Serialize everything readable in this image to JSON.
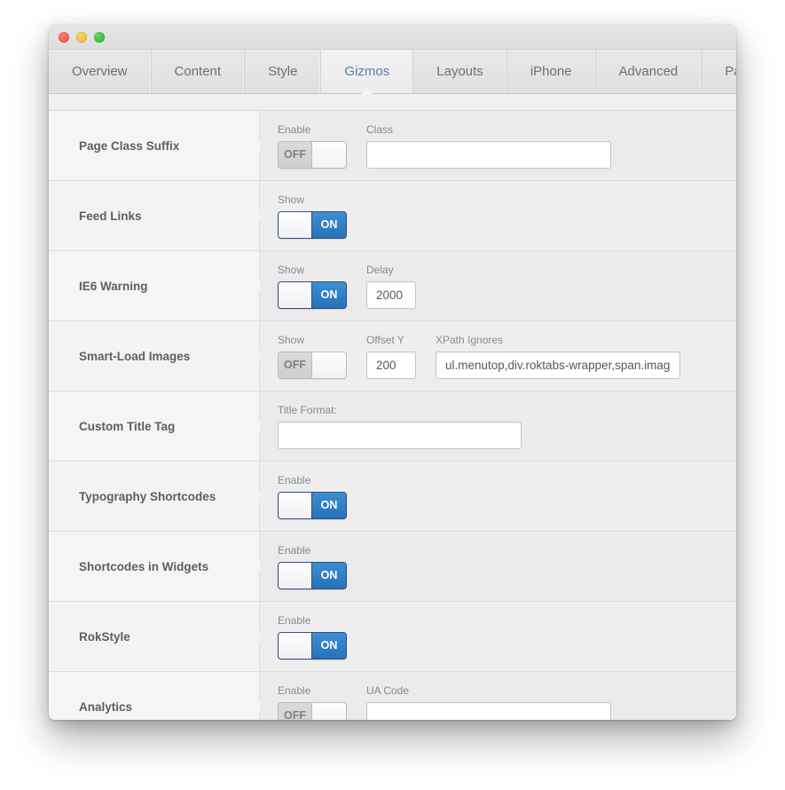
{
  "window": {
    "traffic_lights": [
      "close",
      "minimize",
      "maximize"
    ]
  },
  "tabs": [
    {
      "label": "Overview",
      "active": false
    },
    {
      "label": "Content",
      "active": false
    },
    {
      "label": "Style",
      "active": false
    },
    {
      "label": "Gizmos",
      "active": true
    },
    {
      "label": "Layouts",
      "active": false
    },
    {
      "label": "iPhone",
      "active": false
    },
    {
      "label": "Advanced",
      "active": false
    },
    {
      "label": "Page Templates",
      "active": false
    }
  ],
  "colors": {
    "accent_blue": "#2b7cc4",
    "active_tab_text": "#5579b4",
    "label_text": "#5a5f66",
    "field_label_text": "#868a8e"
  },
  "rows": [
    {
      "title": "Page Class Suffix",
      "toggle_label": "Enable",
      "toggle_state": "OFF",
      "field1_label": "Class",
      "field1_value": ""
    },
    {
      "title": "Feed Links",
      "toggle_label": "Show",
      "toggle_state": "ON"
    },
    {
      "title": "IE6 Warning",
      "toggle_label": "Show",
      "toggle_state": "ON",
      "field1_label": "Delay",
      "field1_value": "2000"
    },
    {
      "title": "Smart-Load Images",
      "toggle_label": "Show",
      "toggle_state": "OFF",
      "field1_label": "Offset Y",
      "field1_value": "200",
      "field2_label": "XPath Ignores",
      "field2_value": "ul.menutop,div.roktabs-wrapper,span.image,div"
    },
    {
      "title": "Custom Title Tag",
      "field1_label": "Title Format:",
      "field1_value": ""
    },
    {
      "title": "Typography Shortcodes",
      "toggle_label": "Enable",
      "toggle_state": "ON"
    },
    {
      "title": "Shortcodes in Widgets",
      "toggle_label": "Enable",
      "toggle_state": "ON"
    },
    {
      "title": "RokStyle",
      "toggle_label": "Enable",
      "toggle_state": "ON"
    },
    {
      "title": "Analytics",
      "toggle_label": "Enable",
      "toggle_state": "OFF",
      "field1_label": "UA Code",
      "field1_value": ""
    }
  ]
}
